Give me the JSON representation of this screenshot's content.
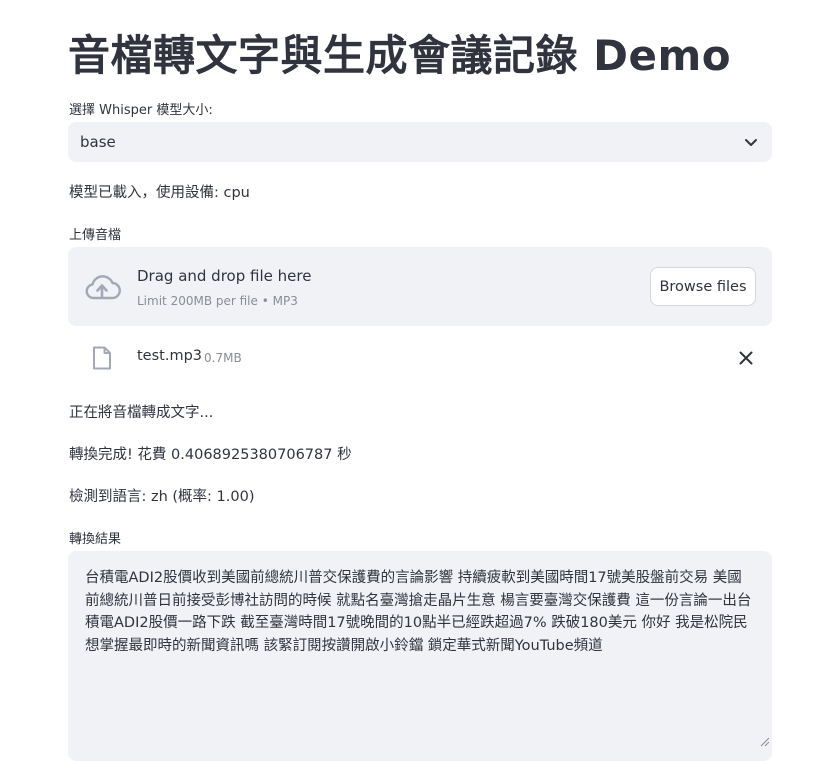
{
  "page": {
    "title": "音檔轉文字與生成會議記錄 Demo"
  },
  "model_select": {
    "label": "選擇 Whisper 模型大小:",
    "value": "base"
  },
  "model_status": "模型已載入，使用設備: cpu",
  "uploader": {
    "label": "上傳音檔",
    "instruction": "Drag and drop file here",
    "limit": "Limit 200MB per file • MP3",
    "browse_label": "Browse files",
    "file": {
      "name": "test.mp3",
      "size": "0.7MB"
    }
  },
  "status": {
    "converting": "正在將音檔轉成文字...",
    "done": "轉換完成! 花費 0.4068925380706787 秒",
    "language": "檢測到語言: zh (概率: 1.00)"
  },
  "result": {
    "label": "轉換結果",
    "text": "台積電ADI2股價收到美國前總統川普交保護費的言論影響 持續疲軟到美國時間17號美股盤前交易 美國前總統川普日前接受彭博社訪問的時候 就點名臺灣搶走晶片生意 楊言要臺灣交保護費 這一份言論一出台積電ADI2股價一路下跌 截至臺灣時間17號晚間的10點半已經跌超過7% 跌破180美元 你好 我是松院民想掌握最即時的新聞資訊嗎 該緊訂閱按讚開啟小鈴鐺 鎖定華式新聞YouTube頻道"
  },
  "icons": {
    "select_chevron": "chevron-down-icon",
    "upload": "cloud-upload-icon",
    "file": "file-icon",
    "remove": "close-icon",
    "resize": "resize-handle-icon"
  },
  "colors": {
    "background": "#ffffff",
    "panel": "#f0f2f6",
    "text": "#31333f",
    "muted": "#8a8d96",
    "icon": "#a3a8b8"
  }
}
